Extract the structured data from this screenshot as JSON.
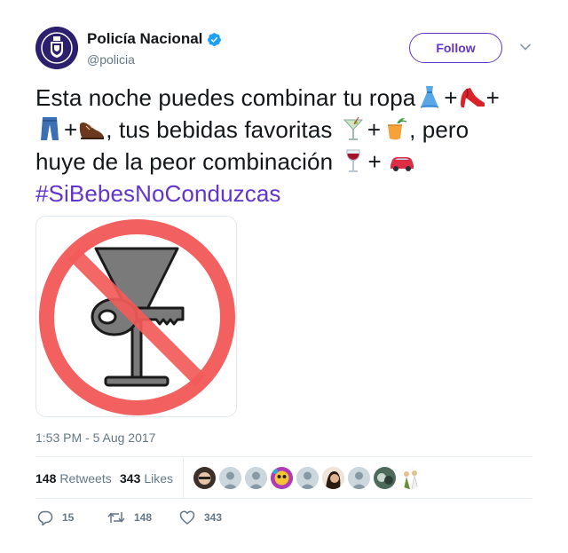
{
  "user": {
    "display_name": "Policía Nacional",
    "handle": "@policia",
    "verified": true
  },
  "follow_label": "Follow",
  "tweet": {
    "line1_text": "Esta noche puedes combinar tu ropa",
    "plus": "+",
    "line2_text": ", tus bebidas favoritas ",
    "line2_end": ", pero",
    "line3_text": "huye de la peor combinación ",
    "line3_plus": "+ ",
    "hashtag": "#SiBebesNoConduzcas",
    "emojis": [
      "dress-emoji",
      "high-heel-emoji",
      "jeans-emoji",
      "shoe-emoji",
      "cocktail-emoji",
      "tropical-drink-emoji",
      "wine-glass-emoji",
      "car-emoji"
    ]
  },
  "timestamp": "1:53 PM - 5 Aug 2017",
  "stats": {
    "retweets_count": "148",
    "retweets_label": "Retweets",
    "likes_count": "343",
    "likes_label": "Likes"
  },
  "actions": {
    "replies": "15",
    "retweets": "148",
    "likes": "343"
  },
  "colors": {
    "accent": "#6335c9",
    "verified": "#1da1f2",
    "muted": "#657786",
    "no_sign_red": "#f35b5b"
  }
}
